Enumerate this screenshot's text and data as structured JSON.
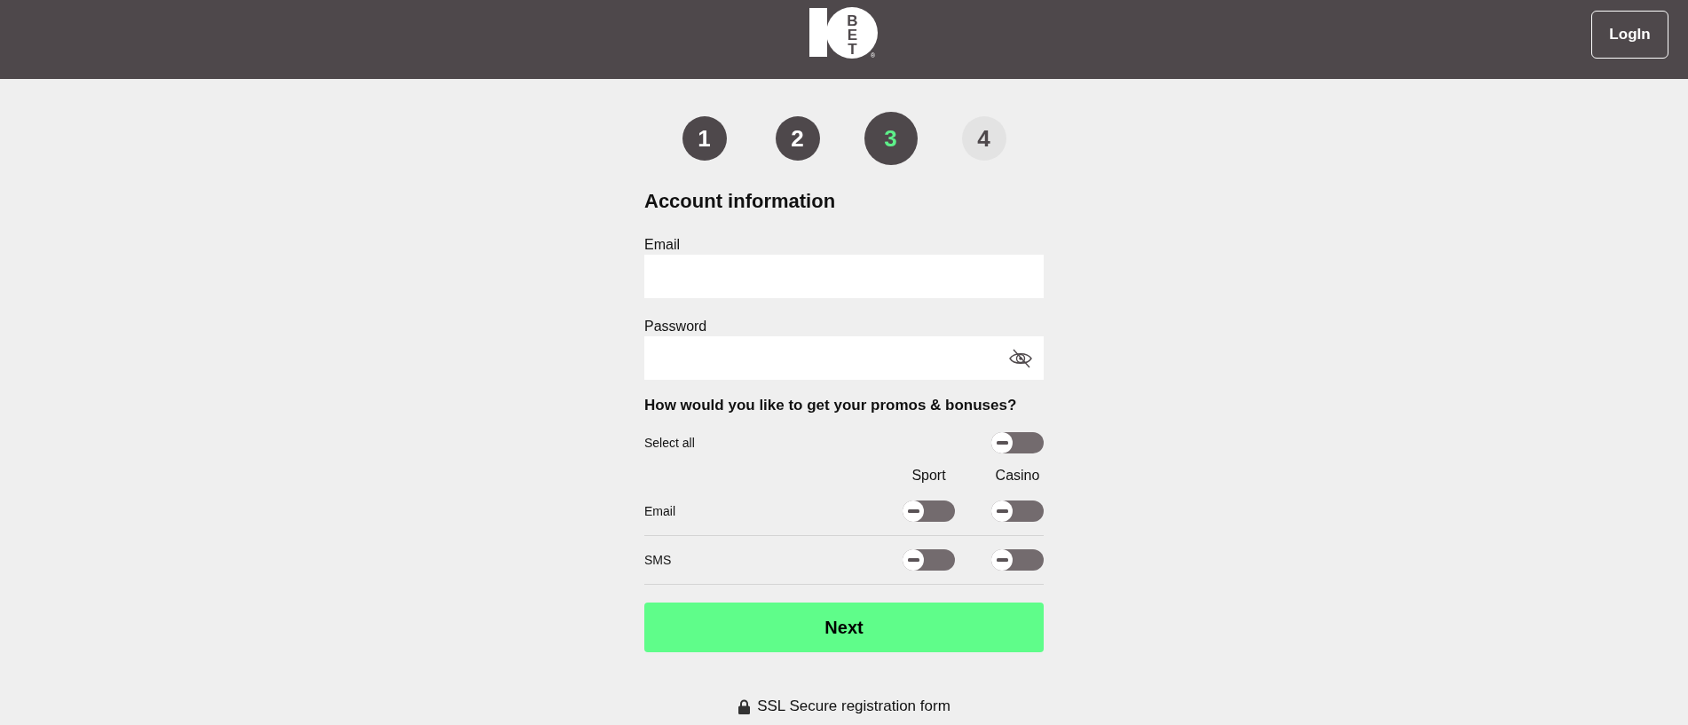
{
  "header": {
    "logo": {
      "letters": "BET",
      "registered": "®"
    },
    "login_button": "LogIn"
  },
  "steps": [
    {
      "label": "1",
      "selected": false
    },
    {
      "label": "2",
      "selected": false
    },
    {
      "label": "3",
      "selected": true
    },
    {
      "label": "4",
      "selected": false
    }
  ],
  "form": {
    "title": "Account information",
    "fields": [
      {
        "kind": "text",
        "label": "Email"
      },
      {
        "kind": "password",
        "label": "Password"
      }
    ],
    "promos": {
      "title": "How would you like to get your promos & bonuses?",
      "select_all": {
        "label": "Select all",
        "on": false
      },
      "columns": [
        "Sport",
        "Casino"
      ],
      "rows": [
        {
          "label": "Email",
          "toggles": [
            {
              "on": false
            },
            {
              "on": false
            }
          ]
        },
        {
          "label": "SMS",
          "toggles": [
            {
              "on": false
            },
            {
              "on": false
            }
          ]
        }
      ]
    },
    "next_button": "Next"
  },
  "footer": {
    "secure_note": "SSL Secure registration form"
  }
}
